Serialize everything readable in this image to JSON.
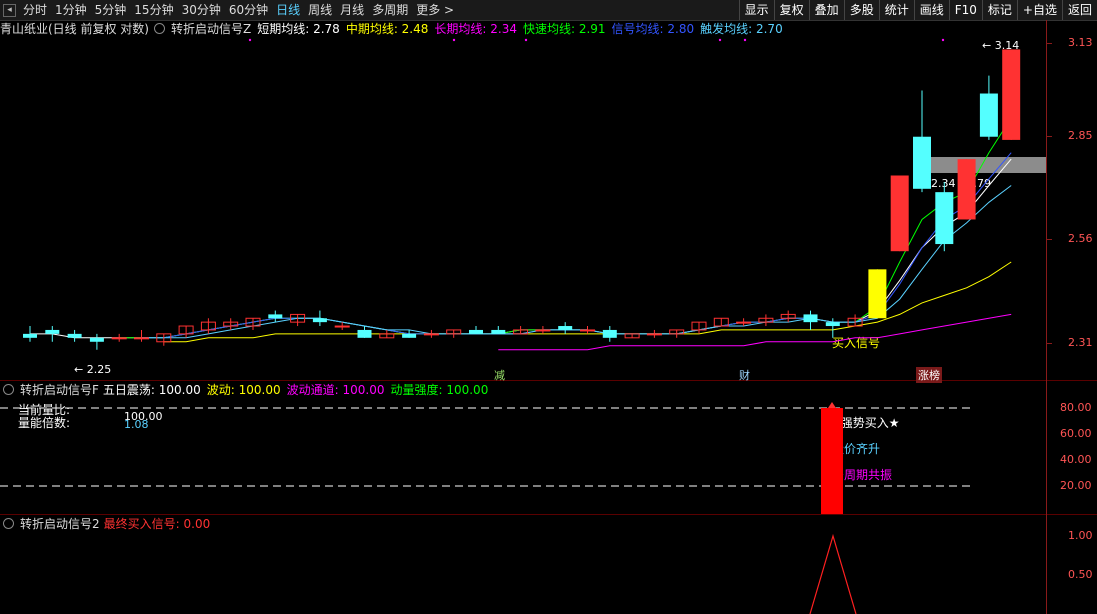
{
  "toolbar": {
    "periods": [
      {
        "label": "分时",
        "active": false
      },
      {
        "label": "1分钟",
        "active": false
      },
      {
        "label": "5分钟",
        "active": false
      },
      {
        "label": "15分钟",
        "active": false
      },
      {
        "label": "30分钟",
        "active": false
      },
      {
        "label": "60分钟",
        "active": false
      },
      {
        "label": "日线",
        "active": true
      },
      {
        "label": "周线",
        "active": false
      },
      {
        "label": "月线",
        "active": false
      },
      {
        "label": "多周期",
        "active": false
      },
      {
        "label": "更多 >",
        "active": false
      }
    ],
    "right_buttons": [
      "显示",
      "复权",
      "叠加",
      "多股",
      "统计",
      "画线",
      "F10",
      "标记",
      "+自选",
      "返回"
    ]
  },
  "main_header": {
    "stock": "青山纸业(日线 前复权 对数)",
    "indicator": "转折启动信号Z",
    "lines": [
      {
        "label": "短期均线: 2.78",
        "color": "#ffffff"
      },
      {
        "label": "中期均线: 2.48",
        "color": "#ffff00"
      },
      {
        "label": "长期均线: 2.34",
        "color": "#ff00ff"
      },
      {
        "label": "快速均线: 2.91",
        "color": "#00ff00"
      },
      {
        "label": "信号均线: 2.80",
        "color": "#3355ff"
      },
      {
        "label": "触发均线: 2.70",
        "color": "#5ad1ff"
      }
    ]
  },
  "main_axis": [
    "3.13",
    "2.85",
    "2.56",
    "2.31"
  ],
  "annotations": {
    "high": "3.14",
    "low": "2.25",
    "range": "2.34 - 2.79",
    "buy_signal": "买入信号",
    "tags": [
      {
        "label": "减",
        "color": "#9be36b"
      },
      {
        "label": "财",
        "color": "#9fd6ff"
      },
      {
        "label": "涨榜",
        "color": "#ffffff"
      }
    ]
  },
  "mid_header": {
    "indicator": "转折启动信号F",
    "items": [
      {
        "label": "五日震荡: 100.00",
        "color": "#ffffff"
      },
      {
        "label": "波动: 100.00",
        "color": "#ffff00"
      },
      {
        "label": "波动通道: 100.00",
        "color": "#ff00ff"
      },
      {
        "label": "动量强度: 100.00",
        "color": "#00ff00"
      }
    ]
  },
  "mid_overlay": {
    "left_labels": [
      "当前量比:",
      "量能倍数:"
    ],
    "val1": "100.00",
    "val2": "1.08",
    "signal1": "★强势买入★",
    "signal2": "量价齐升",
    "signal3": "多周期共振"
  },
  "mid_axis": [
    "80.00",
    "60.00",
    "40.00",
    "20.00"
  ],
  "bottom_header": {
    "indicator": "转折启动信号2",
    "item": "最终买入信号: 0.00"
  },
  "bottom_axis": [
    "1.00",
    "0.50"
  ],
  "colors": {
    "up": "#ff3232",
    "down": "#54ffff",
    "axis": "#ff5555",
    "grid": "#5a0000"
  },
  "chart_data": {
    "type": "candlestick",
    "title": "",
    "ylim": [
      2.2,
      3.18
    ],
    "candles": [
      {
        "o": 2.29,
        "h": 2.31,
        "l": 2.27,
        "c": 2.28
      },
      {
        "o": 2.3,
        "h": 2.31,
        "l": 2.27,
        "c": 2.29
      },
      {
        "o": 2.29,
        "h": 2.3,
        "l": 2.27,
        "c": 2.28
      },
      {
        "o": 2.28,
        "h": 2.29,
        "l": 2.25,
        "c": 2.27
      },
      {
        "o": 2.28,
        "h": 2.29,
        "l": 2.27,
        "c": 2.28
      },
      {
        "o": 2.28,
        "h": 2.3,
        "l": 2.27,
        "c": 2.28
      },
      {
        "o": 2.27,
        "h": 2.29,
        "l": 2.26,
        "c": 2.29
      },
      {
        "o": 2.29,
        "h": 2.31,
        "l": 2.28,
        "c": 2.31
      },
      {
        "o": 2.3,
        "h": 2.33,
        "l": 2.29,
        "c": 2.32
      },
      {
        "o": 2.31,
        "h": 2.33,
        "l": 2.3,
        "c": 2.32
      },
      {
        "o": 2.31,
        "h": 2.33,
        "l": 2.3,
        "c": 2.33
      },
      {
        "o": 2.34,
        "h": 2.35,
        "l": 2.32,
        "c": 2.33
      },
      {
        "o": 2.32,
        "h": 2.34,
        "l": 2.31,
        "c": 2.34
      },
      {
        "o": 2.33,
        "h": 2.35,
        "l": 2.31,
        "c": 2.32
      },
      {
        "o": 2.31,
        "h": 2.32,
        "l": 2.3,
        "c": 2.31
      },
      {
        "o": 2.3,
        "h": 2.31,
        "l": 2.28,
        "c": 2.28
      },
      {
        "o": 2.28,
        "h": 2.3,
        "l": 2.28,
        "c": 2.29
      },
      {
        "o": 2.29,
        "h": 2.3,
        "l": 2.28,
        "c": 2.28
      },
      {
        "o": 2.29,
        "h": 2.3,
        "l": 2.28,
        "c": 2.29
      },
      {
        "o": 2.29,
        "h": 2.3,
        "l": 2.28,
        "c": 2.3
      },
      {
        "o": 2.3,
        "h": 2.31,
        "l": 2.29,
        "c": 2.29
      },
      {
        "o": 2.3,
        "h": 2.31,
        "l": 2.29,
        "c": 2.29
      },
      {
        "o": 2.29,
        "h": 2.31,
        "l": 2.29,
        "c": 2.3
      },
      {
        "o": 2.3,
        "h": 2.31,
        "l": 2.29,
        "c": 2.3
      },
      {
        "o": 2.31,
        "h": 2.32,
        "l": 2.29,
        "c": 2.3
      },
      {
        "o": 2.3,
        "h": 2.31,
        "l": 2.29,
        "c": 2.3
      },
      {
        "o": 2.3,
        "h": 2.31,
        "l": 2.27,
        "c": 2.28
      },
      {
        "o": 2.28,
        "h": 2.29,
        "l": 2.28,
        "c": 2.29
      },
      {
        "o": 2.29,
        "h": 2.3,
        "l": 2.28,
        "c": 2.29
      },
      {
        "o": 2.29,
        "h": 2.3,
        "l": 2.28,
        "c": 2.3
      },
      {
        "o": 2.3,
        "h": 2.32,
        "l": 2.29,
        "c": 2.32
      },
      {
        "o": 2.31,
        "h": 2.33,
        "l": 2.31,
        "c": 2.33
      },
      {
        "o": 2.32,
        "h": 2.33,
        "l": 2.31,
        "c": 2.32
      },
      {
        "o": 2.32,
        "h": 2.34,
        "l": 2.31,
        "c": 2.33
      },
      {
        "o": 2.33,
        "h": 2.35,
        "l": 2.32,
        "c": 2.34
      },
      {
        "o": 2.34,
        "h": 2.35,
        "l": 2.3,
        "c": 2.32
      },
      {
        "o": 2.32,
        "h": 2.33,
        "l": 2.28,
        "c": 2.31
      },
      {
        "o": 2.31,
        "h": 2.34,
        "l": 2.31,
        "c": 2.33
      },
      {
        "o": 2.33,
        "h": 2.45,
        "l": 2.33,
        "c": 2.46
      },
      {
        "o": 2.51,
        "h": 2.67,
        "l": 2.51,
        "c": 2.73
      },
      {
        "o": 2.85,
        "h": 3.0,
        "l": 2.68,
        "c": 2.69
      },
      {
        "o": 2.68,
        "h": 2.71,
        "l": 2.51,
        "c": 2.53
      },
      {
        "o": 2.6,
        "h": 2.78,
        "l": 2.6,
        "c": 2.78
      },
      {
        "o": 2.99,
        "h": 3.05,
        "l": 2.84,
        "c": 2.85
      },
      {
        "o": 2.84,
        "h": 3.14,
        "l": 2.84,
        "c": 3.14
      }
    ],
    "series": [
      {
        "name": "短期均线",
        "color": "#ffffff",
        "values": [
          2.29,
          2.29,
          2.28,
          2.28,
          2.28,
          2.28,
          2.28,
          2.29,
          2.3,
          2.31,
          2.32,
          2.33,
          2.33,
          2.33,
          2.32,
          2.31,
          2.3,
          2.29,
          2.29,
          2.29,
          2.29,
          2.29,
          2.3,
          2.3,
          2.3,
          2.3,
          2.29,
          2.29,
          2.29,
          2.29,
          2.3,
          2.31,
          2.32,
          2.32,
          2.33,
          2.33,
          2.32,
          2.32,
          2.35,
          2.43,
          2.52,
          2.58,
          2.62,
          2.7,
          2.78
        ]
      },
      {
        "name": "中期均线",
        "color": "#ffff00",
        "values": [
          null,
          null,
          null,
          null,
          null,
          null,
          2.27,
          2.27,
          2.28,
          2.28,
          2.28,
          2.29,
          2.29,
          2.29,
          2.29,
          2.29,
          2.29,
          2.29,
          2.29,
          2.29,
          2.29,
          2.29,
          2.29,
          2.29,
          2.29,
          2.29,
          2.29,
          2.29,
          2.29,
          2.29,
          2.29,
          2.3,
          2.3,
          2.3,
          2.3,
          2.3,
          2.3,
          2.31,
          2.32,
          2.34,
          2.37,
          2.39,
          2.41,
          2.44,
          2.48
        ]
      },
      {
        "name": "长期均线",
        "color": "#ff00ff",
        "values": [
          null,
          null,
          null,
          null,
          null,
          null,
          null,
          null,
          null,
          null,
          null,
          null,
          null,
          null,
          null,
          null,
          null,
          null,
          null,
          null,
          null,
          2.25,
          2.25,
          2.25,
          2.25,
          2.25,
          2.26,
          2.26,
          2.26,
          2.26,
          2.26,
          2.26,
          2.26,
          2.27,
          2.27,
          2.27,
          2.27,
          2.28,
          2.28,
          2.29,
          2.3,
          2.31,
          2.32,
          2.33,
          2.34
        ]
      },
      {
        "name": "快速均线",
        "color": "#00ff00",
        "values": [
          null,
          null,
          null,
          null,
          2.28,
          2.28,
          2.28,
          2.29,
          2.3,
          2.31,
          2.32,
          2.33,
          2.33,
          2.33,
          2.32,
          2.31,
          2.3,
          2.29,
          2.29,
          2.29,
          2.29,
          2.29,
          2.3,
          2.3,
          2.3,
          2.3,
          2.29,
          2.29,
          2.29,
          2.29,
          2.3,
          2.31,
          2.32,
          2.32,
          2.33,
          2.33,
          2.32,
          2.32,
          2.36,
          2.48,
          2.6,
          2.65,
          2.68,
          2.8,
          2.91
        ]
      },
      {
        "name": "信号均线",
        "color": "#3355ff",
        "values": [
          null,
          null,
          null,
          null,
          null,
          2.28,
          2.28,
          2.29,
          2.3,
          2.31,
          2.32,
          2.33,
          2.33,
          2.33,
          2.32,
          2.31,
          2.3,
          2.29,
          2.29,
          2.29,
          2.29,
          2.29,
          2.29,
          2.3,
          2.3,
          2.3,
          2.29,
          2.29,
          2.29,
          2.29,
          2.3,
          2.31,
          2.32,
          2.32,
          2.33,
          2.33,
          2.32,
          2.32,
          2.34,
          2.42,
          2.52,
          2.6,
          2.64,
          2.72,
          2.8
        ]
      },
      {
        "name": "触发均线",
        "color": "#5ad1ff",
        "values": [
          null,
          null,
          null,
          null,
          null,
          2.28,
          2.28,
          2.28,
          2.29,
          2.3,
          2.31,
          2.32,
          2.33,
          2.33,
          2.32,
          2.31,
          2.3,
          2.3,
          2.29,
          2.29,
          2.29,
          2.29,
          2.29,
          2.3,
          2.3,
          2.3,
          2.29,
          2.29,
          2.29,
          2.29,
          2.3,
          2.31,
          2.31,
          2.32,
          2.32,
          2.33,
          2.32,
          2.32,
          2.33,
          2.38,
          2.46,
          2.54,
          2.59,
          2.65,
          2.7
        ]
      }
    ]
  }
}
